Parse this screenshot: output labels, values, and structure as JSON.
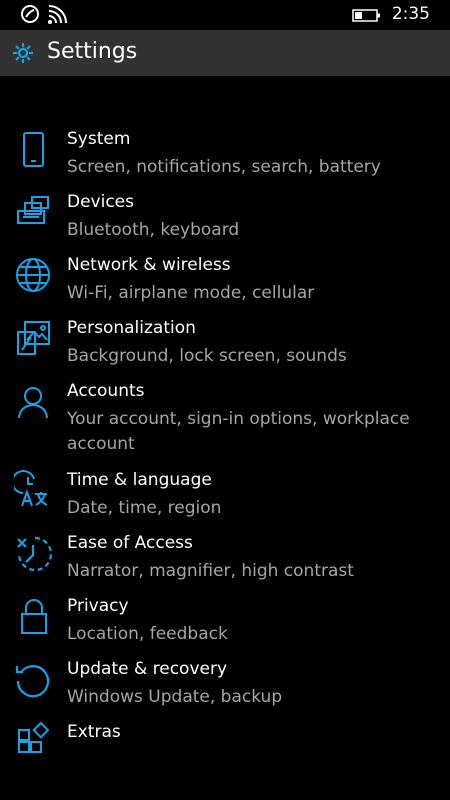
{
  "status": {
    "time": "2:35",
    "icons": [
      "nfc-icon",
      "wifi-icon",
      "battery-icon"
    ]
  },
  "header": {
    "title": "Settings",
    "icon": "gear-icon",
    "accent": "#1ba1e2"
  },
  "items": [
    {
      "label": "System",
      "sub": "Screen, notifications, search, battery",
      "icon": "phone-icon"
    },
    {
      "label": "Devices",
      "sub": "Bluetooth, keyboard",
      "icon": "devices-icon"
    },
    {
      "label": "Network & wireless",
      "sub": "Wi-Fi, airplane mode, cellular",
      "icon": "globe-icon"
    },
    {
      "label": "Personalization",
      "sub": "Background, lock screen, sounds",
      "icon": "personalization-icon"
    },
    {
      "label": "Accounts",
      "sub": "Your account, sign-in options, workplace account",
      "icon": "person-icon"
    },
    {
      "label": "Time & language",
      "sub": "Date, time, region",
      "icon": "time-language-icon"
    },
    {
      "label": "Ease of Access",
      "sub": "Narrator, magnifier, high contrast",
      "icon": "ease-of-access-icon"
    },
    {
      "label": "Privacy",
      "sub": "Location, feedback",
      "icon": "lock-icon"
    },
    {
      "label": "Update & recovery",
      "sub": "Windows Update, backup",
      "icon": "update-icon"
    },
    {
      "label": "Extras",
      "sub": "",
      "icon": "extras-icon"
    }
  ]
}
